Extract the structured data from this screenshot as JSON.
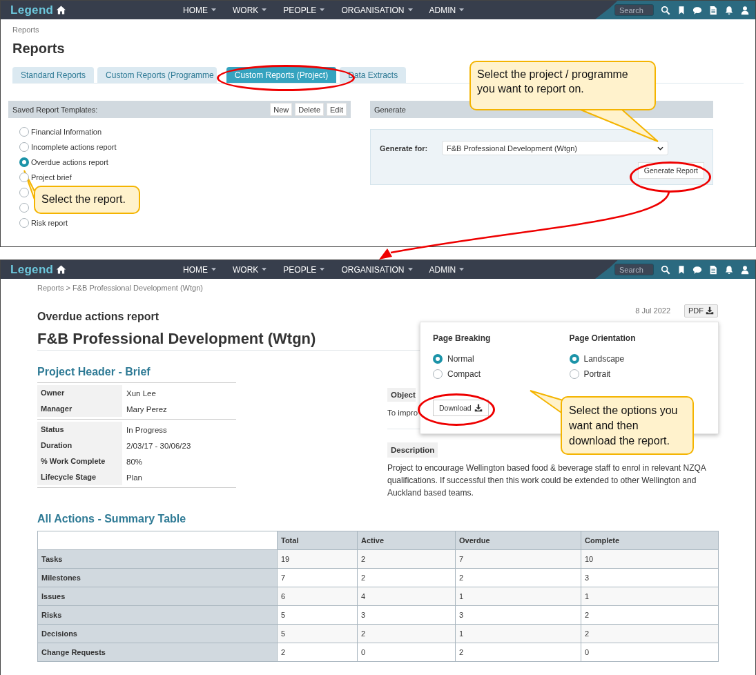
{
  "screen_1": {
    "nav": {
      "logo": "Legend",
      "menus": [
        "HOME",
        "WORK",
        "PEOPLE",
        "ORGANISATION",
        "ADMIN"
      ],
      "search": {
        "placeholder": "Search"
      }
    },
    "breadcrumb": "Reports",
    "title": "Reports",
    "tabs": [
      {
        "label": "Standard Reports",
        "selected": false
      },
      {
        "label": "Custom Reports (Programme",
        "selected": false
      },
      {
        "label": "Custom Reports (Project)",
        "selected": true
      },
      {
        "label": "Data Extracts",
        "selected": false
      }
    ],
    "templates": {
      "title": "Saved Report Templates:",
      "buttons": [
        "New",
        "Delete",
        "Edit"
      ],
      "items": [
        {
          "label": "Financial Information",
          "selected": false
        },
        {
          "label": "Incomplete actions report",
          "selected": false
        },
        {
          "label": "Overdue actions report",
          "selected": true
        },
        {
          "label": "Project brief",
          "selected": false
        },
        {
          "selected": false
        },
        {
          "selected": false
        },
        {
          "label": "Risk report",
          "selected": false
        }
      ]
    },
    "generate": {
      "title": "Generate",
      "label": "Generate for:",
      "value": "F&B Professional Development (Wtgn)",
      "button": "Generate Report"
    },
    "callouts": [
      "Select the project / programme you want to report on.",
      "Select the report."
    ]
  },
  "screen_2": {
    "nav": {
      "logo": "Legend",
      "menus": [
        "HOME",
        "WORK",
        "PEOPLE",
        "ORGANISATION",
        "ADMIN"
      ],
      "search": {
        "placeholder": "Search"
      }
    },
    "breadcrumb": "Reports > F&B Professional Development (Wtgn)",
    "report_name": "Overdue actions report",
    "date": "8 Jul 2022",
    "pdf_button": "PDF",
    "title": "F&B Professional Development (Wtgn)",
    "section_1": "Project Header - Brief",
    "details": [
      [
        {
          "label": "Owner",
          "value": "Xun Lee"
        },
        {
          "label": "Manager",
          "value": "Mary Perez"
        }
      ],
      [
        {
          "label": "Status",
          "value": "In Progress"
        },
        {
          "label": "Duration",
          "value": "2/03/17 - 30/06/23"
        },
        {
          "label": "% Work Complete",
          "value": "80%"
        },
        {
          "label": "Lifecycle Stage",
          "value": "Plan"
        }
      ]
    ],
    "objective": {
      "heading": "Object",
      "text": "To impro"
    },
    "description": {
      "heading": "Description",
      "text": "Project to encourage Wellington based food & beverage staff to enrol in relevant NZQA qualifications. If successful then this work could be extended to other Wellington and Auckland based teams."
    },
    "popup": {
      "groups": [
        {
          "title": "Page Breaking",
          "options": [
            {
              "label": "Normal",
              "selected": true
            },
            {
              "label": "Compact",
              "selected": false
            }
          ]
        },
        {
          "title": "Page Orientation",
          "options": [
            {
              "label": "Landscape",
              "selected": true
            },
            {
              "label": "Portrait",
              "selected": false
            }
          ]
        }
      ],
      "button": "Download"
    },
    "callout": "Select the options you want and then download the report.",
    "section_2": "All Actions - Summary Table",
    "table": {
      "columns": [
        "Total",
        "Active",
        "Overdue",
        "Complete"
      ],
      "rows": [
        {
          "label": "Tasks",
          "values": [
            "19",
            "2",
            "7",
            "10"
          ]
        },
        {
          "label": "Milestones",
          "values": [
            "7",
            "2",
            "2",
            "3"
          ]
        },
        {
          "label": "Issues",
          "values": [
            "6",
            "4",
            "1",
            "1"
          ]
        },
        {
          "label": "Risks",
          "values": [
            "5",
            "3",
            "3",
            "2"
          ]
        },
        {
          "label": "Decisions",
          "values": [
            "5",
            "2",
            "1",
            "2"
          ]
        },
        {
          "label": "Change Requests",
          "values": [
            "2",
            "0",
            "2",
            "0"
          ]
        }
      ]
    }
  }
}
